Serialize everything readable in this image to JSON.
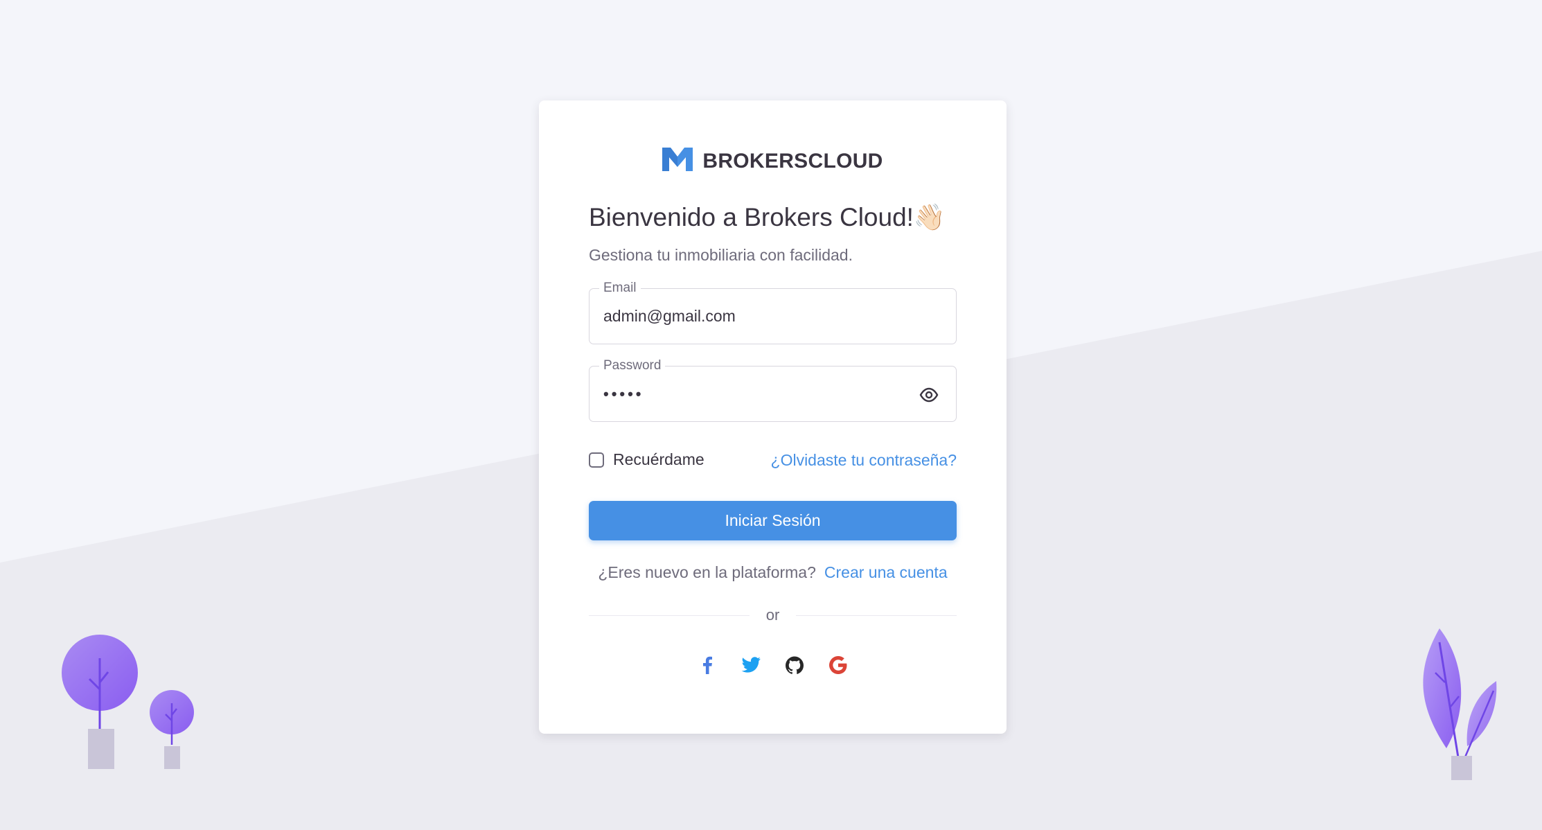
{
  "brand": {
    "name": "BROKERSCLOUD",
    "logo_icon": "m-logo-icon",
    "color": "#4690e4"
  },
  "login": {
    "title": "Bienvenido a Brokers Cloud!👋🏻",
    "subtitle": "Gestiona tu inmobiliaria con facilidad.",
    "email": {
      "label": "Email",
      "value": "admin@gmail.com"
    },
    "password": {
      "label": "Password",
      "value": "•••••",
      "toggle_icon": "eye-icon"
    },
    "remember_label": "Recuérdame",
    "forgot_label": "¿Olvidaste tu contraseña?",
    "submit_label": "Iniciar Sesión",
    "signup_question": "¿Eres nuevo en la plataforma?",
    "signup_link": "Crear una cuenta",
    "divider_text": "or",
    "socials": [
      {
        "name": "facebook-icon",
        "color": "#497ce2"
      },
      {
        "name": "twitter-icon",
        "color": "#1da1f2"
      },
      {
        "name": "github-icon",
        "color": "#272727"
      },
      {
        "name": "google-icon",
        "color": "#db4437"
      }
    ]
  },
  "colors": {
    "primary": "#4690e4",
    "background": "#f4f5fa",
    "text": "#3a3541",
    "muted": "#6e6b7b"
  }
}
